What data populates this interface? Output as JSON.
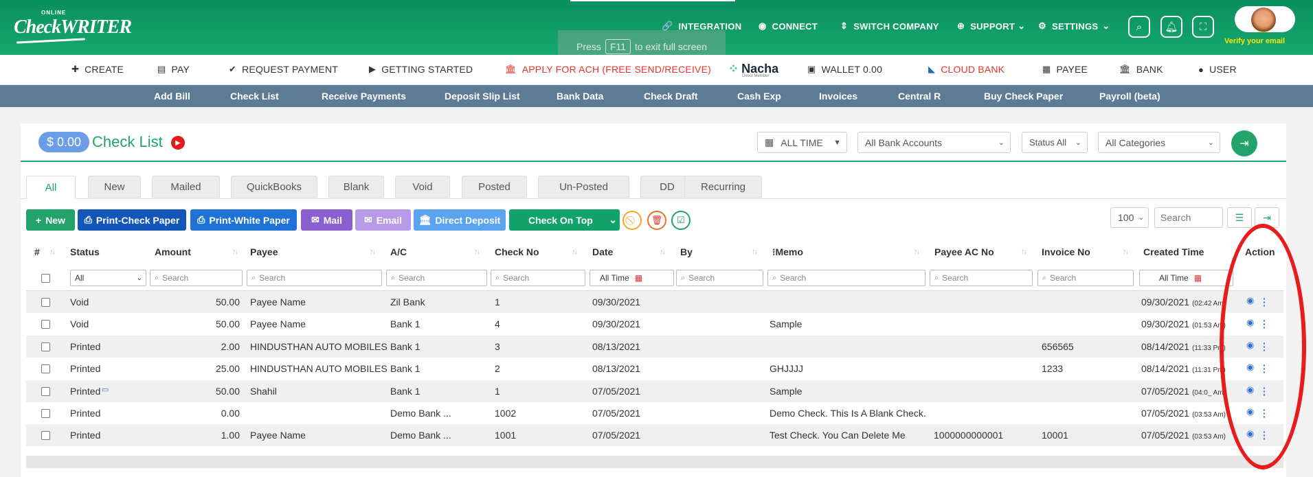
{
  "app": {
    "logo_small": "ONLINE",
    "logo": "CheckWRITER",
    "verify_text": "Verify your email",
    "fullscreen_hint_pre": "Press",
    "fullscreen_key": "F11",
    "fullscreen_hint_post": "to exit full screen"
  },
  "topnav": {
    "integration": "INTEGRATION",
    "connect": "CONNECT",
    "switch_company": "SWITCH COMPANY",
    "support": "SUPPORT",
    "settings": "SETTINGS"
  },
  "menubar": {
    "create": "CREATE",
    "pay": "PAY",
    "request_payment": "REQUEST PAYMENT",
    "getting_started": "GETTING STARTED",
    "apply_ach": "APPLY FOR ACH (FREE SEND/RECEIVE)",
    "nacha": "Nacha",
    "nacha_sub": "Direct Member",
    "wallet": "WALLET 0.00",
    "cloud_bank": "CLOUD BANK",
    "payee": "PAYEE",
    "bank": "BANK",
    "user": "USER"
  },
  "subnav": [
    "Add Bill",
    "Check List",
    "Receive Payments",
    "Deposit Slip List",
    "Bank Data",
    "Check Draft",
    "Cash Exp",
    "Invoices",
    "Central R",
    "Buy Check Paper",
    "Payroll (beta)"
  ],
  "page": {
    "balance": "$ 0.00",
    "title": "Check List"
  },
  "filters": {
    "time": "ALL TIME",
    "bank_accounts": "All Bank Accounts",
    "status": "Status All",
    "categories": "All Categories"
  },
  "tabs": [
    "All",
    "New",
    "Mailed",
    "QuickBooks",
    "Blank",
    "Void",
    "Posted",
    "Un-Posted",
    "DD",
    "Recurring"
  ],
  "toolbar": {
    "new": "New",
    "print_check": "Print-Check Paper",
    "print_white": "Print-White Paper",
    "mail": "Mail",
    "email": "Email",
    "direct_deposit": "Direct Deposit",
    "check_on_top": "Check On Top",
    "page_size": "100",
    "search_placeholder": "Search"
  },
  "table": {
    "headers": [
      "#",
      "Status",
      "Amount",
      "Payee",
      "A/C",
      "Check No",
      "Date",
      "By",
      "Memo",
      "Payee AC No",
      "Invoice No",
      "Created Time",
      "Action"
    ],
    "filter_status": "All",
    "filter_search": "Search",
    "filter_all_time": "All Time",
    "rows": [
      {
        "status": "Void",
        "amount": "50.00",
        "payee": "Payee Name",
        "ac": "Zil Bank",
        "check_no": "1",
        "date": "09/30/2021",
        "memo": "",
        "payee_ac": "",
        "invoice": "",
        "created": "09/30/2021",
        "created_time": "(02:42 Am)"
      },
      {
        "status": "Void",
        "amount": "50.00",
        "payee": "Payee Name",
        "ac": "Bank 1",
        "check_no": "4",
        "date": "09/30/2021",
        "memo": "Sample",
        "payee_ac": "",
        "invoice": "",
        "created": "09/30/2021",
        "created_time": "(01:53 Am)"
      },
      {
        "status": "Printed",
        "amount": "2.00",
        "payee": "HINDUSTHAN AUTO MOBILES",
        "ac": "Bank 1",
        "check_no": "3",
        "date": "08/13/2021",
        "memo": "",
        "payee_ac": "",
        "invoice": "656565",
        "created": "08/14/2021",
        "created_time": "(11:33 Pm)"
      },
      {
        "status": "Printed",
        "amount": "25.00",
        "payee": "HINDUSTHAN AUTO MOBILES",
        "ac": "Bank 1",
        "check_no": "2",
        "date": "08/13/2021",
        "memo": "GHJJJJ",
        "payee_ac": "",
        "invoice": "1233",
        "created": "08/14/2021",
        "created_time": "(11:31 Pm)"
      },
      {
        "status": "Printed",
        "amount": "50.00",
        "payee": "Shahil",
        "ac": "Bank 1",
        "check_no": "1",
        "date": "07/05/2021",
        "memo": "Sample",
        "payee_ac": "",
        "invoice": "",
        "created": "07/05/2021",
        "created_time": "(04:0_ Am)"
      },
      {
        "status": "Printed",
        "amount": "0.00",
        "payee": "",
        "ac": "Demo Bank ...",
        "check_no": "1002",
        "date": "07/05/2021",
        "memo": "Demo Check. This Is A Blank Check.",
        "payee_ac": "",
        "invoice": "",
        "created": "07/05/2021",
        "created_time": "(03:53 Am)"
      },
      {
        "status": "Printed",
        "amount": "1.00",
        "payee": "Payee Name",
        "ac": "Demo Bank ...",
        "check_no": "1001",
        "date": "07/05/2021",
        "memo": "Test Check. You Can Delete Me",
        "payee_ac": "1000000000001",
        "invoice": "10001",
        "created": "07/05/2021",
        "created_time": "(03:53 Am)"
      }
    ]
  },
  "colors": {
    "brand_green": "#16a86e",
    "subnav": "#5e7b95",
    "annotation": "#e81c1c"
  }
}
